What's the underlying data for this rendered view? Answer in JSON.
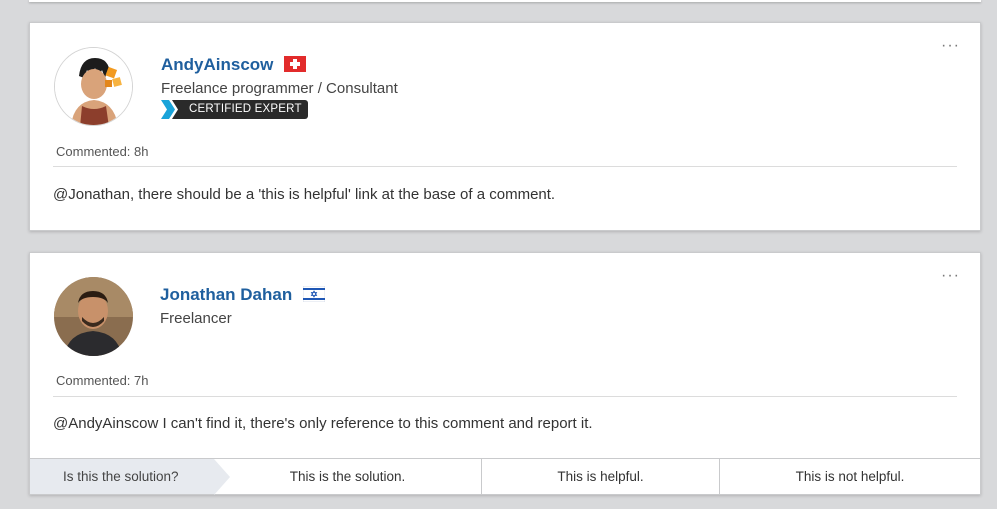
{
  "comments": [
    {
      "name": "AndyAinscow",
      "flag_icon": "switzerland-flag-icon",
      "title": "Freelance programmer / Consultant",
      "badge": "CERTIFIED EXPERT",
      "commented": "Commented: 8h",
      "text": "@Jonathan, there should be a 'this is helpful' link at the base of a comment.",
      "menu": "···"
    },
    {
      "name": "Jonathan Dahan",
      "flag_icon": "israel-flag-icon",
      "title": "Freelancer",
      "commented": "Commented: 7h",
      "text": "@AndyAinscow I can't find it, there's only reference to this comment and report it.",
      "menu": "···"
    }
  ],
  "actions": {
    "question": "Is this the solution?",
    "solution": "This is the solution.",
    "helpful": "This is helpful.",
    "not_helpful": "This is not helpful."
  },
  "colors": {
    "background": "#d8d9db",
    "link_name": "#1f5f9e",
    "badge_dark": "#2a2a2a",
    "badge_accent": "#1aa3d9"
  }
}
